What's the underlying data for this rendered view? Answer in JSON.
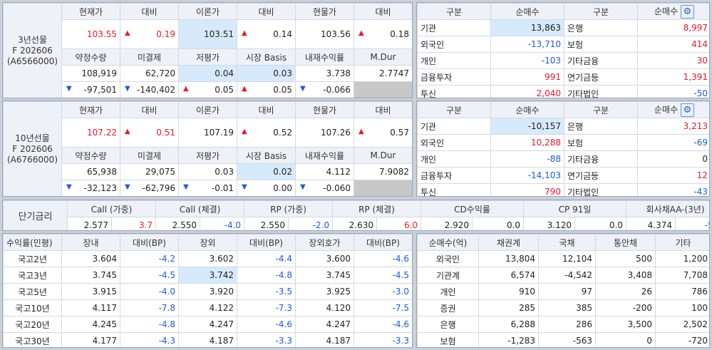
{
  "futures": [
    {
      "label": "3년선물\nF 202606\n(A6566000)",
      "headers1": [
        "현재가",
        "대비",
        "이론가",
        "대비",
        "현물가",
        "대비"
      ],
      "row1": {
        "price": "103.55",
        "chg": "0.19",
        "chg_dir": "up",
        "theo": "103.51",
        "theo_chg": "0.14",
        "theo_dir": "up",
        "spot": "103.56",
        "spot_chg": "0.18",
        "spot_dir": "up"
      },
      "headers2": [
        "약정수량",
        "미결제",
        "저평가",
        "시장 Basis",
        "내재수익률",
        "M.Dur"
      ],
      "row2": {
        "vol": "108,919",
        "oi": "62,720",
        "under": "0.04",
        "basis": "0.03",
        "irr": "3.738",
        "mdur": "2.7747"
      },
      "row3": {
        "vol_chg": "-97,501",
        "oi_chg": "-140,402",
        "under_chg": "0.05",
        "basis_chg": "0.05",
        "irr_chg": "-0.066"
      }
    },
    {
      "label": "10년선물\nF 202606\n(A6766000)",
      "headers1": [
        "현재가",
        "대비",
        "이론가",
        "대비",
        "현물가",
        "대비"
      ],
      "row1": {
        "price": "107.22",
        "chg": "0.51",
        "chg_dir": "up",
        "theo": "107.19",
        "theo_chg": "0.52",
        "theo_dir": "up",
        "spot": "107.26",
        "spot_chg": "0.57",
        "spot_dir": "up"
      },
      "headers2": [
        "약정수량",
        "미결제",
        "저평가",
        "시장 Basis",
        "내재수익률",
        "M.Dur"
      ],
      "row2": {
        "vol": "65,938",
        "oi": "29,075",
        "under": "0.03",
        "basis": "0.02",
        "irr": "4.112",
        "mdur": "7.9082"
      },
      "row3": {
        "vol_chg": "-32,123",
        "oi_chg": "-62,796",
        "under_chg": "-0.01",
        "basis_chg": "0.00",
        "irr_chg": "-0.060"
      }
    }
  ],
  "investors": [
    {
      "headers": [
        "구분",
        "순매수",
        "구분",
        "순매수"
      ],
      "rows": [
        {
          "a": "기관",
          "av": "13,863",
          "ac": "black",
          "b": "은행",
          "bv": "8,997",
          "bc": "red"
        },
        {
          "a": "외국인",
          "av": "-13,710",
          "ac": "blue",
          "b": "보험",
          "bv": "414",
          "bc": "red"
        },
        {
          "a": "개인",
          "av": "-103",
          "ac": "blue",
          "b": "기타금융",
          "bv": "30",
          "bc": "red"
        },
        {
          "a": "금융투자",
          "av": "991",
          "ac": "red",
          "b": "연기금등",
          "bv": "1,391",
          "bc": "red"
        },
        {
          "a": "투신",
          "av": "2,040",
          "ac": "red",
          "b": "기타법인",
          "bv": "-50",
          "bc": "blue"
        }
      ]
    },
    {
      "headers": [
        "구분",
        "순매수",
        "구분",
        "순매수"
      ],
      "rows": [
        {
          "a": "기관",
          "av": "-10,157",
          "ac": "black",
          "b": "은행",
          "bv": "3,213",
          "bc": "red"
        },
        {
          "a": "외국인",
          "av": "10,288",
          "ac": "red",
          "b": "보험",
          "bv": "-69",
          "bc": "blue"
        },
        {
          "a": "개인",
          "av": "-88",
          "ac": "blue",
          "b": "기타금융",
          "bv": "0",
          "bc": "black"
        },
        {
          "a": "금융투자",
          "av": "-14,103",
          "ac": "blue",
          "b": "연기금등",
          "bv": "12",
          "bc": "red"
        },
        {
          "a": "투신",
          "av": "790",
          "ac": "red",
          "b": "기타법인",
          "bv": "-43",
          "bc": "blue"
        }
      ]
    }
  ],
  "short_rates": {
    "label": "단기금리",
    "headers": [
      "Call (가중)",
      "Call (체결)",
      "RP (가중)",
      "RP (체결)",
      "CD수익률",
      "CP 91일",
      "회사채AA-(3년)"
    ],
    "values": [
      {
        "v": "2.577",
        "c": "3.7",
        "cc": "red"
      },
      {
        "v": "2.550",
        "c": "-4.0",
        "cc": "blue"
      },
      {
        "v": "2.550",
        "c": "-2.0",
        "cc": "blue"
      },
      {
        "v": "2.630",
        "c": "6.0",
        "cc": "red"
      },
      {
        "v": "2.920",
        "c": "0.0",
        "cc": "black"
      },
      {
        "v": "3.120",
        "c": "0.0",
        "cc": "black"
      },
      {
        "v": "4.374",
        "c": "-5.9",
        "cc": "blue"
      }
    ]
  },
  "yields": {
    "headers": [
      "수익률(민평)",
      "장내",
      "대비(BP)",
      "장외",
      "대비(BP)",
      "장외호가",
      "대비(BP)"
    ],
    "rows": [
      {
        "name": "국고2년",
        "a": "3.604",
        "ac": "-4.2",
        "b": "3.602",
        "bc": "-4.4",
        "c": "3.600",
        "cc": "-4.6"
      },
      {
        "name": "국고3년",
        "a": "3.745",
        "ac": "-4.5",
        "b": "3.742",
        "bc": "-4.8",
        "c": "3.745",
        "cc": "-4.5"
      },
      {
        "name": "국고5년",
        "a": "3.915",
        "ac": "-4.0",
        "b": "3.920",
        "bc": "-3.5",
        "c": "3.925",
        "cc": "-3.0"
      },
      {
        "name": "국고10년",
        "a": "4.117",
        "ac": "-7.8",
        "b": "4.122",
        "bc": "-7.3",
        "c": "4.120",
        "cc": "-7.5"
      },
      {
        "name": "국고20년",
        "a": "4.245",
        "ac": "-4.8",
        "b": "4.247",
        "bc": "-4.6",
        "c": "4.247",
        "cc": "-4.6"
      },
      {
        "name": "국고30년",
        "a": "4.177",
        "ac": "-4.3",
        "b": "4.187",
        "bc": "-3.3",
        "c": "4.187",
        "cc": "-3.3"
      }
    ]
  },
  "net_buy": {
    "headers": [
      "순매수(억)",
      "채권계",
      "국채",
      "통안채",
      "기타"
    ],
    "rows": [
      {
        "name": "외국인",
        "a": "13,804",
        "b": "12,104",
        "c": "500",
        "d": "1,200"
      },
      {
        "name": "기관계",
        "a": "6,574",
        "b": "-4,542",
        "c": "3,408",
        "d": "7,708"
      },
      {
        "name": "개인",
        "a": "910",
        "b": "97",
        "c": "26",
        "d": "786"
      },
      {
        "name": "증권",
        "a": "285",
        "b": "385",
        "c": "-200",
        "d": "100"
      },
      {
        "name": "은행",
        "a": "6,288",
        "b": "286",
        "c": "3,500",
        "d": "2,502"
      },
      {
        "name": "보험",
        "a": "-1,283",
        "b": "-563",
        "c": "0",
        "d": "-720"
      }
    ]
  },
  "icons": {
    "settings": "gear-icon",
    "up": "triangle-up-icon",
    "down": "triangle-down-icon"
  },
  "colors": {
    "up": "#e8182e",
    "down": "#1f5ad8",
    "header_bg": "#eef2f8",
    "selected": "#d7eafc"
  }
}
